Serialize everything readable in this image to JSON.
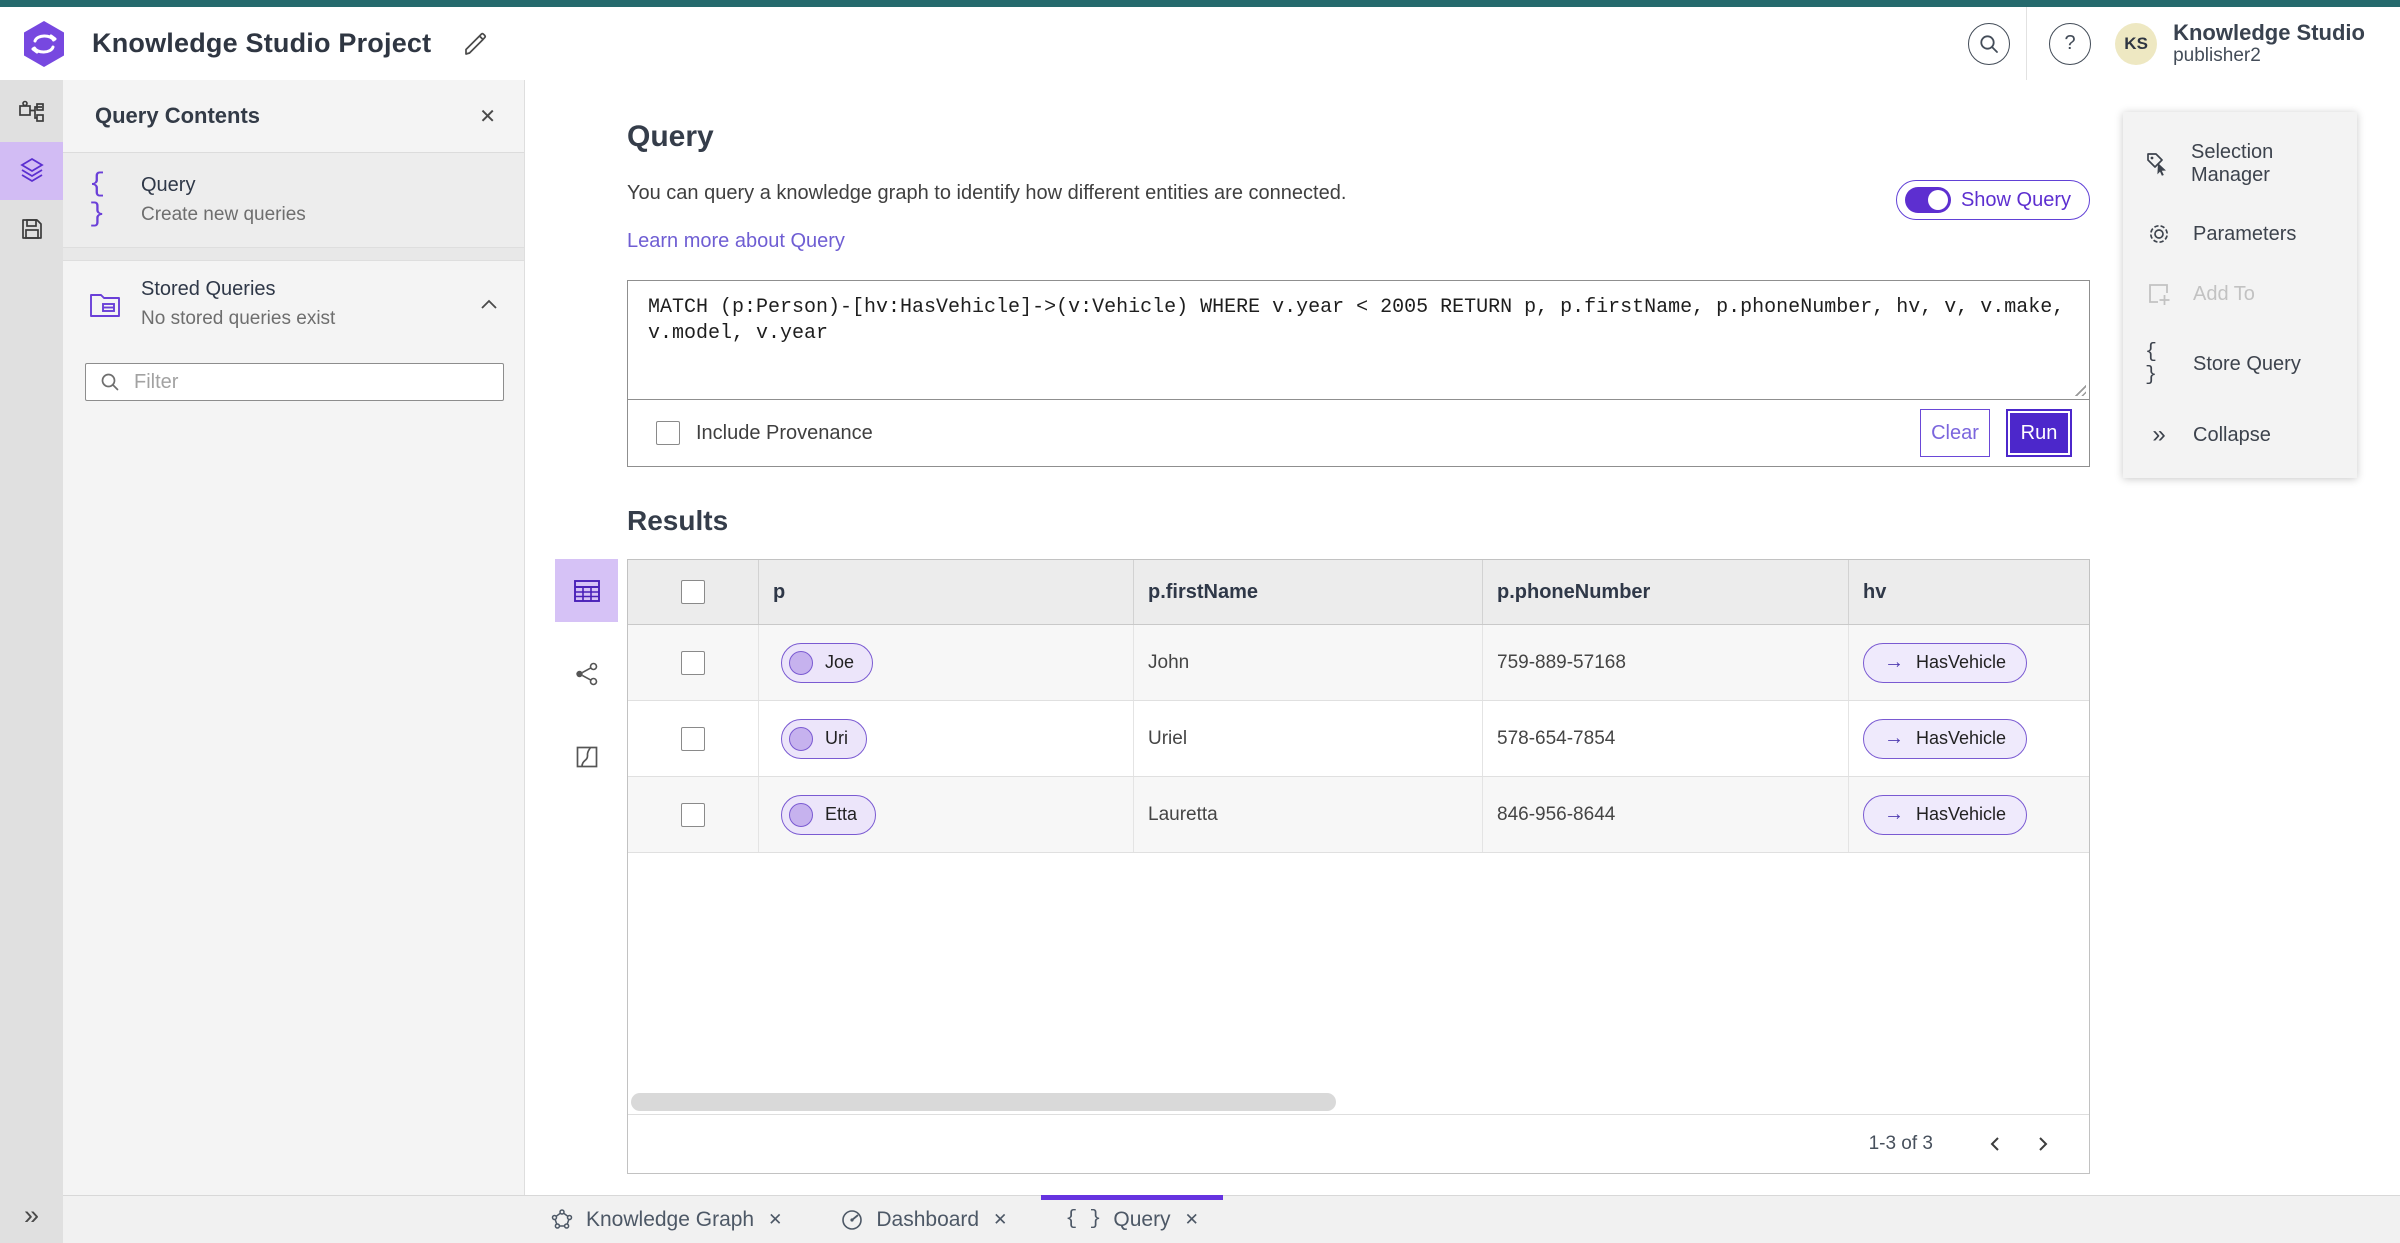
{
  "app": {
    "accent_purple": "#5d2fd0",
    "teal_bar": "#256a6d",
    "rail_selected_bg": "#d2bcf4",
    "pill_border": "#7a5ad2",
    "pill_bg": "#ece5fa"
  },
  "header": {
    "title": "Knowledge Studio Project",
    "product_name": "Knowledge Studio",
    "user_name": "publisher2",
    "avatar_initials": "KS"
  },
  "icons": {
    "close": "✕",
    "help": "?",
    "braces": "{ }",
    "edge_arrow": "→",
    "chevron_double": "»"
  },
  "left_panel": {
    "title": "Query Contents",
    "query_item": {
      "label": "Query",
      "description": "Create new queries"
    },
    "stored_queries": {
      "label": "Stored Queries",
      "description": "No stored queries exist"
    },
    "filter_placeholder": "Filter"
  },
  "query_section": {
    "heading": "Query",
    "description": "You can query a knowledge graph to identify how different entities are connected.",
    "learn_more_label": "Learn more about Query",
    "show_query_label": "Show Query",
    "query_text": "MATCH (p:Person)-[hv:HasVehicle]->(v:Vehicle) WHERE v.year < 2005 RETURN p, p.firstName, p.phoneNumber, hv, v, v.make, v.model, v.year",
    "include_provenance_label": "Include Provenance",
    "clear_label": "Clear",
    "run_label": "Run"
  },
  "results": {
    "heading": "Results",
    "columns": [
      "p",
      "p.firstName",
      "p.phoneNumber",
      "hv"
    ],
    "rows": [
      {
        "p": "Joe",
        "firstName": "John",
        "phone": "759-889-57168",
        "hv": "HasVehicle"
      },
      {
        "p": "Uri",
        "firstName": "Uriel",
        "phone": "578-654-7854",
        "hv": "HasVehicle"
      },
      {
        "p": "Etta",
        "firstName": "Lauretta",
        "phone": "846-956-8644",
        "hv": "HasVehicle"
      }
    ],
    "pagination": {
      "range_label": "1-3 of 3"
    }
  },
  "right_panel": {
    "items": [
      {
        "label": "Selection Manager"
      },
      {
        "label": "Parameters"
      },
      {
        "label": "Add To"
      },
      {
        "label": "Store Query"
      },
      {
        "label": "Collapse"
      }
    ]
  },
  "tabs": [
    {
      "label": "Knowledge Graph"
    },
    {
      "label": "Dashboard"
    },
    {
      "label": "Query"
    }
  ]
}
